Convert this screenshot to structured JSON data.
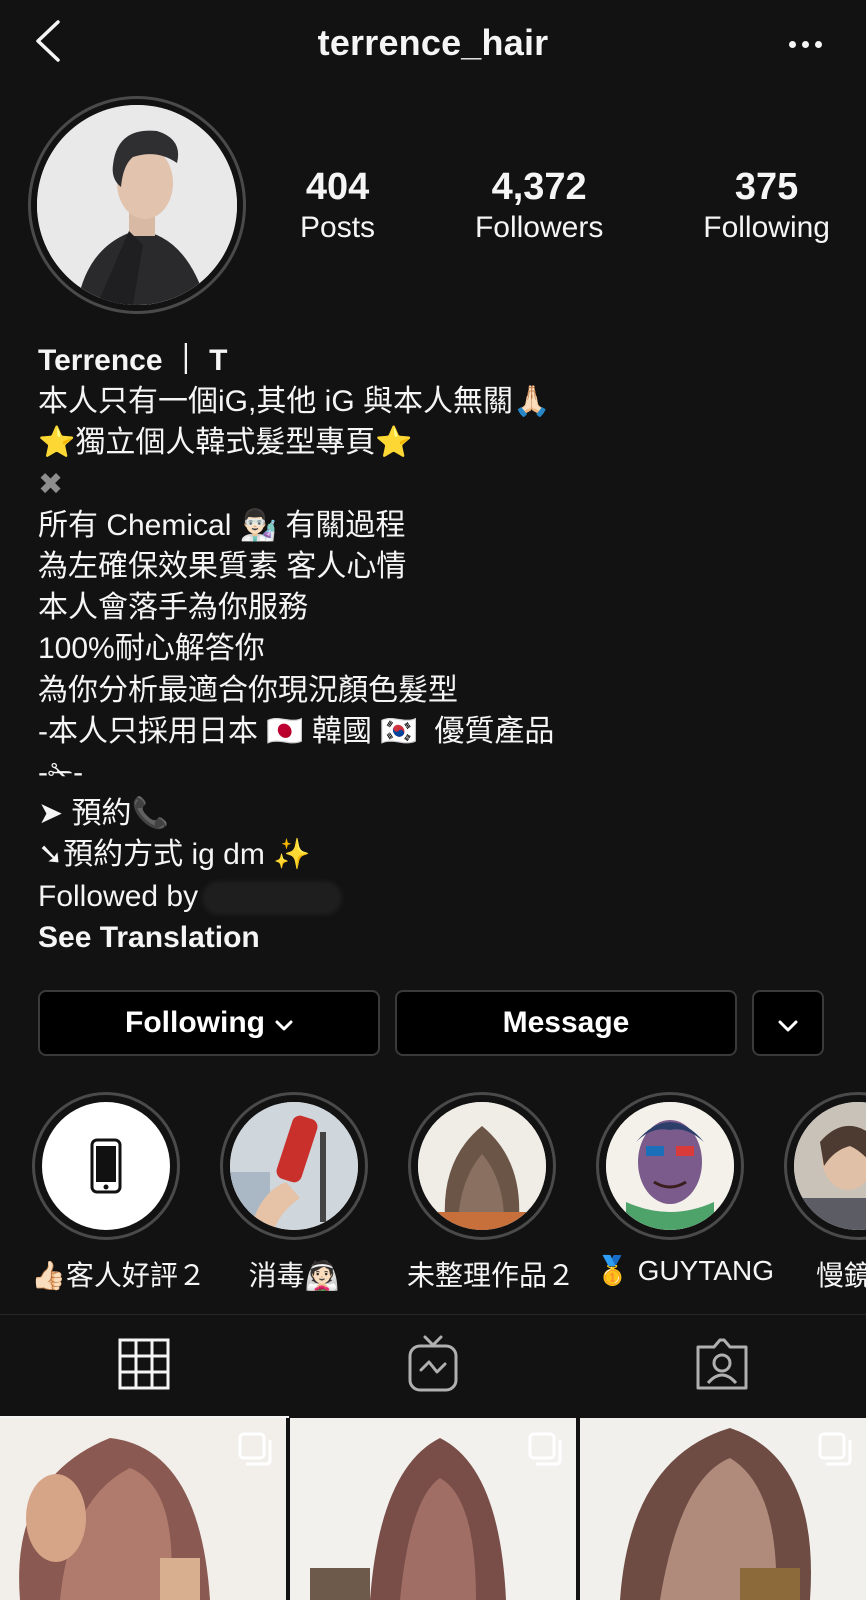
{
  "header": {
    "username": "terrence_hair"
  },
  "stats": [
    {
      "value": "404",
      "label": "Posts"
    },
    {
      "value": "4,372",
      "label": "Followers"
    },
    {
      "value": "375",
      "label": "Following"
    }
  ],
  "bio": {
    "name": "Terrence ｜ T",
    "lines": [
      "本人只有一個iG,其他 iG 與本人無關🙏🏻",
      "⭐獨立個人韓式髮型專頁⭐",
      "✖",
      "所有 Chemical 👨🏻‍🔬 有關過程",
      "為左確保效果質素 客人心情",
      "本人會落手為你服務",
      "100%耐心解答你",
      "為你分析最適合你現況顏色髮型",
      "-本人只採用日本 🇯🇵 韓國 🇰🇷  優質產品",
      "-✁-",
      "➤ 預約📞",
      "➘預約方式 ig dm ✨"
    ],
    "followed_by": "Followed by",
    "see_translation": "See Translation"
  },
  "actions": {
    "following": "Following",
    "message": "Message"
  },
  "highlights": [
    {
      "label": "👍🏻客人好評２",
      "icon": "phone-icon"
    },
    {
      "label": "消毒👰🏻",
      "icon": "thermometer-photo"
    },
    {
      "label": "未整理作品２",
      "icon": "hair-photo"
    },
    {
      "label": "🥇 GUYTANG",
      "icon": "art-photo"
    },
    {
      "label": "慢鏡系",
      "icon": "salon-photo"
    }
  ],
  "tabs": [
    {
      "name": "grid",
      "icon": "grid-icon",
      "active": true
    },
    {
      "name": "igtv",
      "icon": "igtv-icon",
      "active": false
    },
    {
      "name": "tagged",
      "icon": "tagged-icon",
      "active": false
    }
  ],
  "colors": {
    "background": "#121212",
    "text": "#f5f5f5",
    "border": "#3a3a3a",
    "button": "#000000"
  }
}
